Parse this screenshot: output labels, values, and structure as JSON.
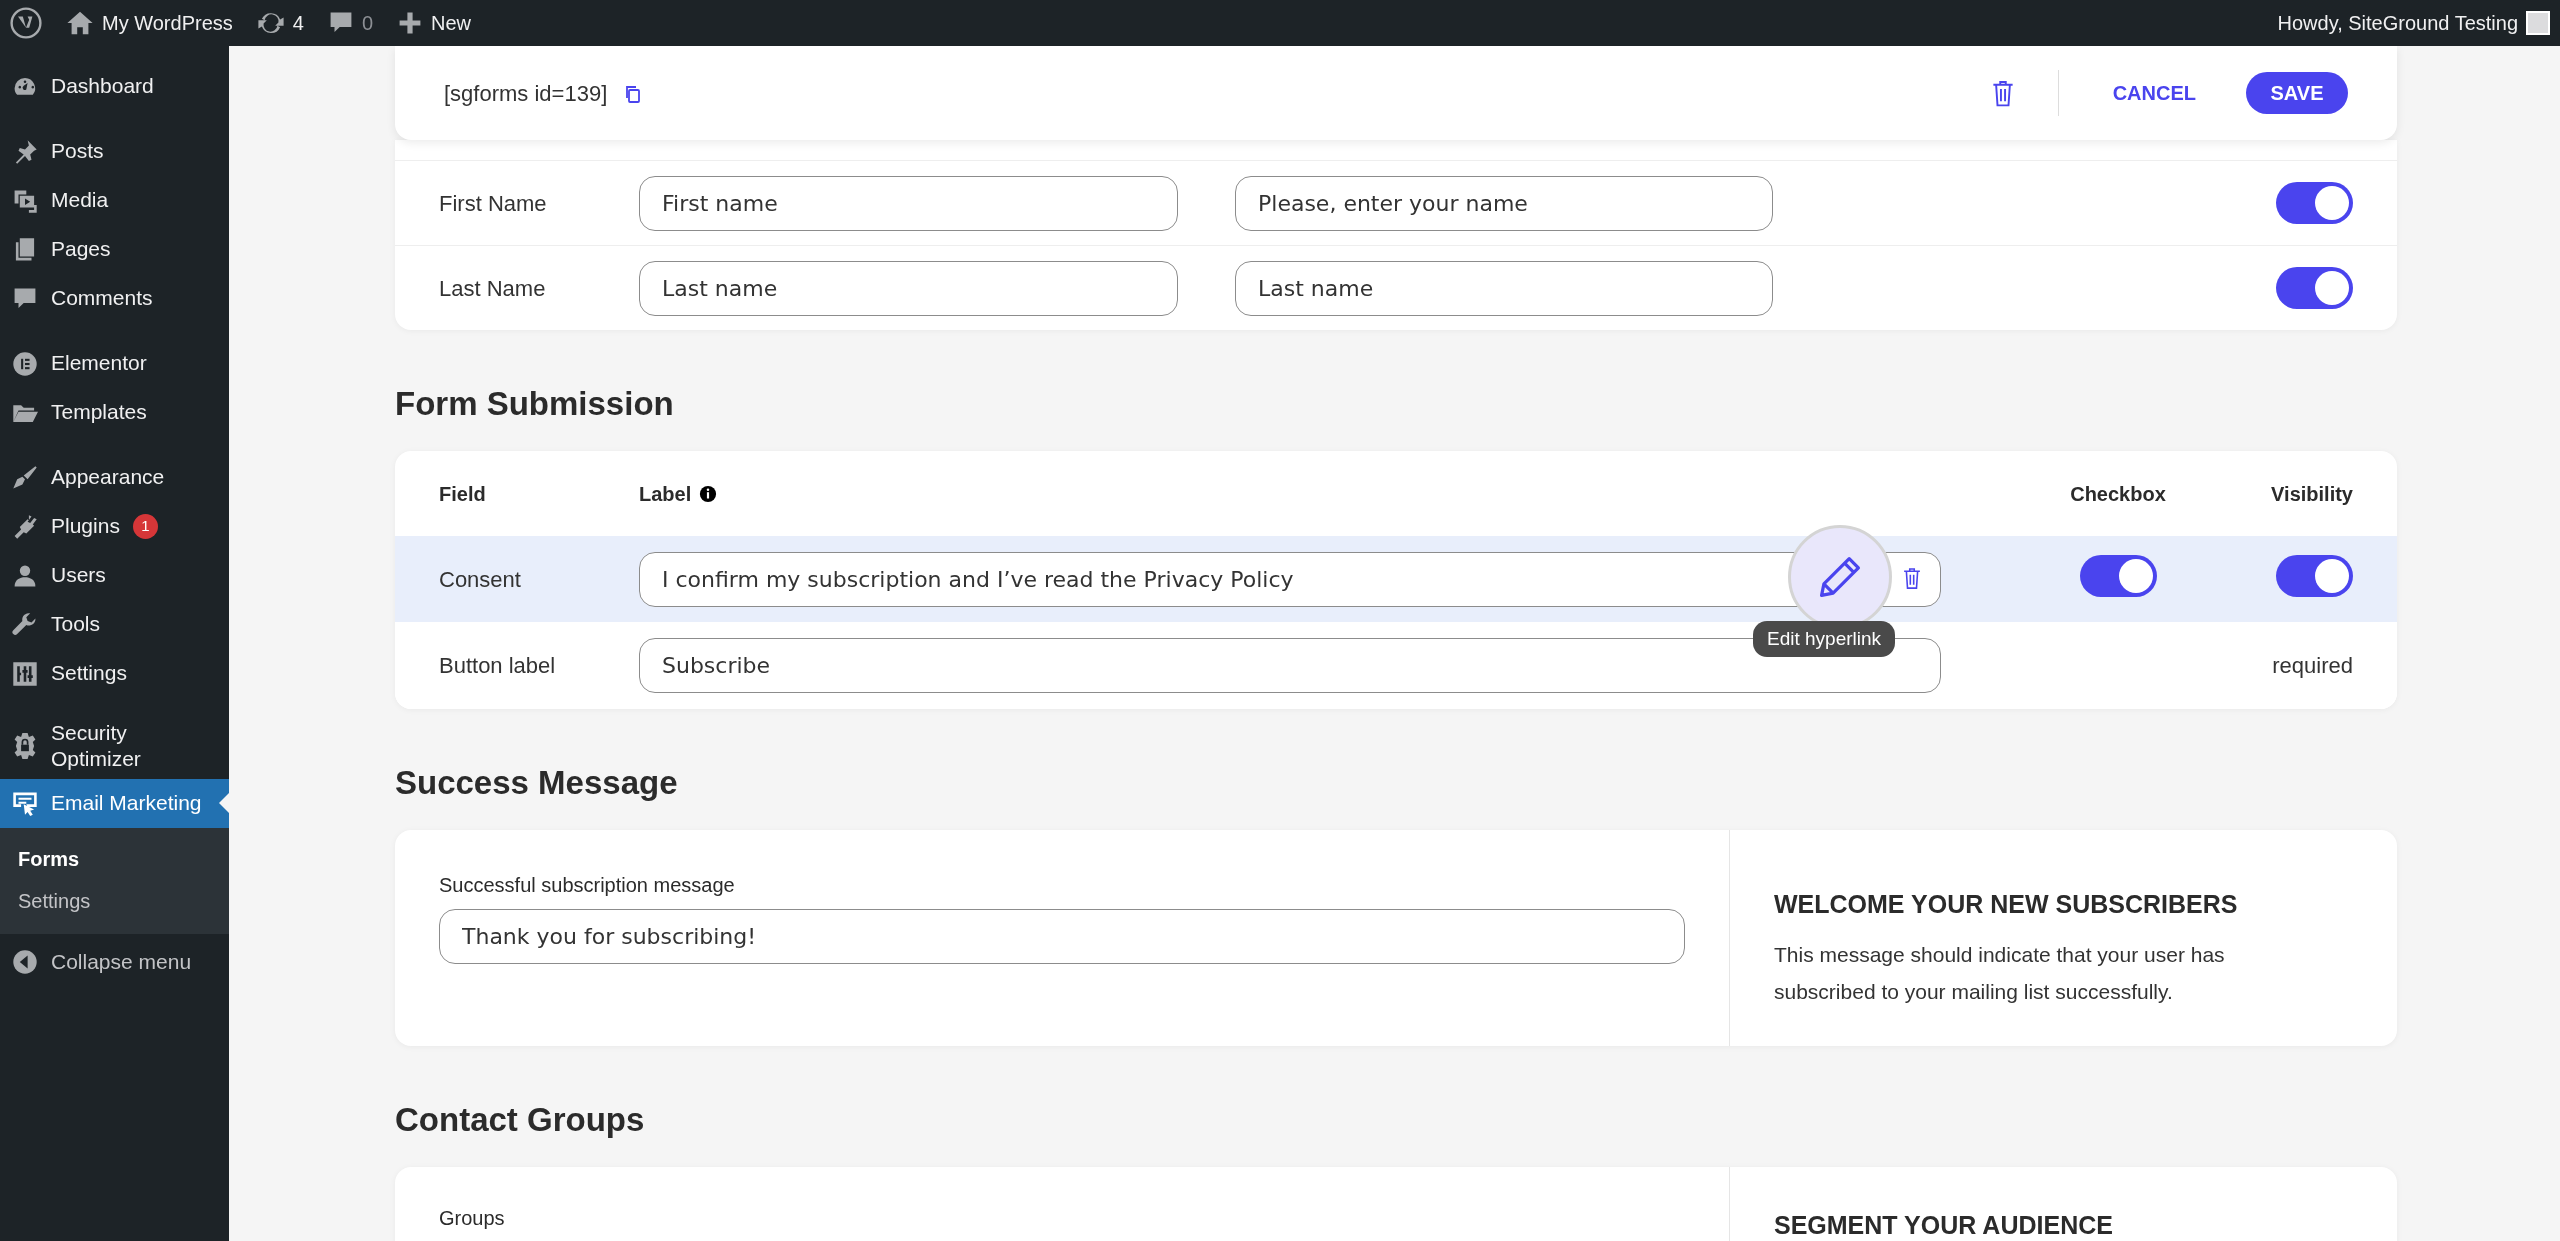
{
  "admin_bar": {
    "site": "My WordPress",
    "updates": "4",
    "comments": "0",
    "new": "New",
    "greeting": "Howdy, SiteGround Testing"
  },
  "sidebar": {
    "groups": [
      {
        "items": [
          {
            "label": "Dashboard",
            "selected": false
          }
        ]
      },
      {
        "items": [
          {
            "label": "Posts",
            "selected": false
          },
          {
            "label": "Media",
            "selected": false
          },
          {
            "label": "Pages",
            "selected": false
          },
          {
            "label": "Comments",
            "selected": false
          }
        ]
      },
      {
        "items": [
          {
            "label": "Elementor",
            "selected": false
          },
          {
            "label": "Templates",
            "selected": false
          }
        ]
      },
      {
        "items": [
          {
            "label": "Appearance",
            "selected": false
          },
          {
            "label": "Plugins",
            "selected": false,
            "badge": "1"
          },
          {
            "label": "Users",
            "selected": false
          },
          {
            "label": "Tools",
            "selected": false
          },
          {
            "label": "Settings",
            "selected": false
          }
        ]
      },
      {
        "items": [
          {
            "label": "Security Optimizer",
            "selected": false
          },
          {
            "label": "Email Marketing",
            "selected": true,
            "children": [
              {
                "label": "Forms",
                "selected": true
              },
              {
                "label": "Settings",
                "selected": false
              }
            ]
          }
        ]
      }
    ],
    "collapse": "Collapse menu"
  },
  "header": {
    "shortcode": "[sgforms id=139]",
    "cancel": "CANCEL",
    "save": "SAVE"
  },
  "fields": [
    {
      "field": "First Name",
      "label_value": "First name",
      "message_value": "Please, enter your name",
      "visible": true
    },
    {
      "field": "Last Name",
      "label_value": "Last name",
      "message_value": "Last name",
      "visible": true
    }
  ],
  "form_submission": {
    "title": "Form Submission",
    "columns": [
      "Field",
      "Label",
      "Checkbox",
      "Visibility"
    ],
    "rows": [
      {
        "field": "Consent",
        "value": "I confirm my subscription and I’ve read the Privacy Policy",
        "selected": true,
        "checkbox": true,
        "visible": true
      },
      {
        "field": "Button label",
        "value": "Subscribe",
        "selected": false,
        "visibility_text": "required"
      }
    ],
    "tooltip": "Edit hyperlink"
  },
  "success_message": {
    "title": "Success Message",
    "field_label": "Successful subscription message",
    "value": "Thank you for subscribing!",
    "aside_title": "WELCOME YOUR NEW SUBSCRIBERS",
    "aside_text": "This message should indicate that your user has subscribed to your mailing list successfully."
  },
  "contact_groups": {
    "title": "Contact Groups",
    "field_label": "Groups",
    "aside_title": "SEGMENT YOUR AUDIENCE"
  }
}
